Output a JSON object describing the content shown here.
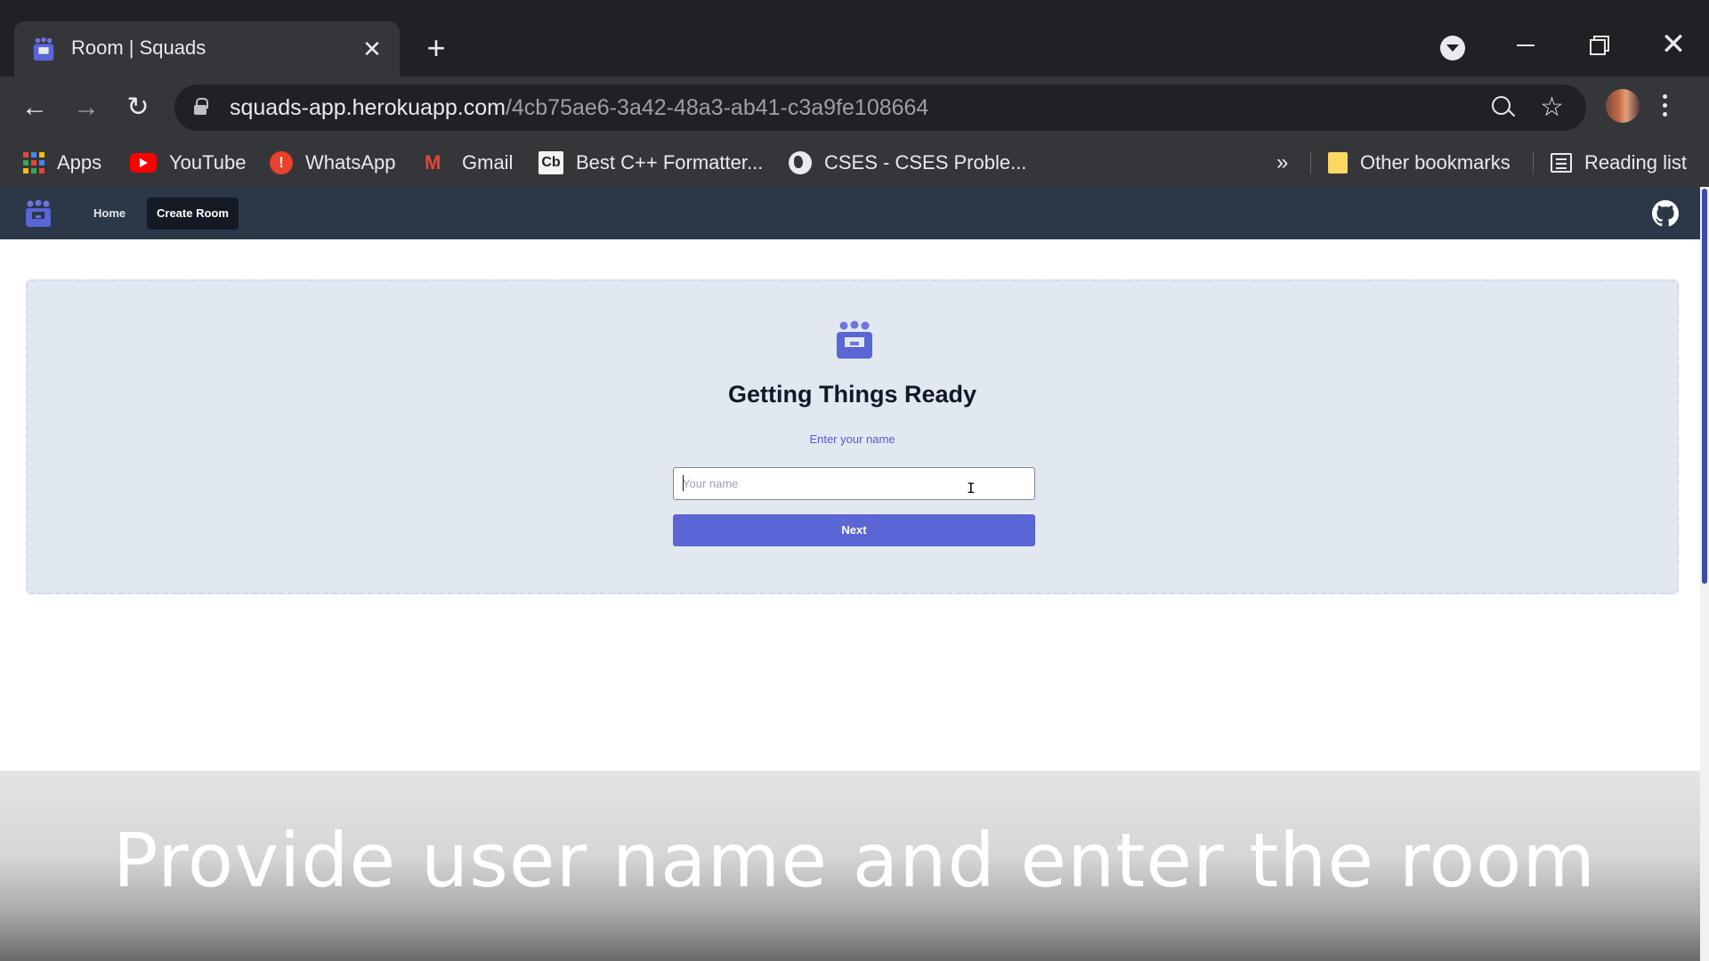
{
  "browser": {
    "tab": {
      "title": "Room | Squads",
      "close_symbol": "✕"
    },
    "new_tab_symbol": "+",
    "address": {
      "host": "squads-app.herokuapp.com",
      "path": "/4cb75ae6-3a42-48a3-ab41-c3a9fe108664"
    },
    "bookmarks": [
      {
        "label": "Apps",
        "icon": "apps-grid-icon"
      },
      {
        "label": "YouTube",
        "icon": "youtube-icon"
      },
      {
        "label": "WhatsApp",
        "icon": "whatsapp-icon"
      },
      {
        "label": "Gmail",
        "icon": "gmail-icon"
      },
      {
        "label": "Best C++ Formatter...",
        "icon": "codebeautify-icon"
      },
      {
        "label": "CSES - CSES Proble...",
        "icon": "globe-icon"
      }
    ],
    "overflow_symbol": "»",
    "other_bookmarks": "Other bookmarks",
    "reading_list": "Reading list"
  },
  "app": {
    "nav": {
      "home": "Home",
      "create_room": "Create Room"
    },
    "card": {
      "title": "Getting Things Ready",
      "subtitle": "Enter your name",
      "input_value": "",
      "input_placeholder": "Your name",
      "next_label": "Next"
    }
  },
  "caption": "Provide user name and enter the room",
  "colors": {
    "nav_bg": "#2c3748",
    "accent": "#5a65d6",
    "card_bg": "#e2e8f0"
  }
}
